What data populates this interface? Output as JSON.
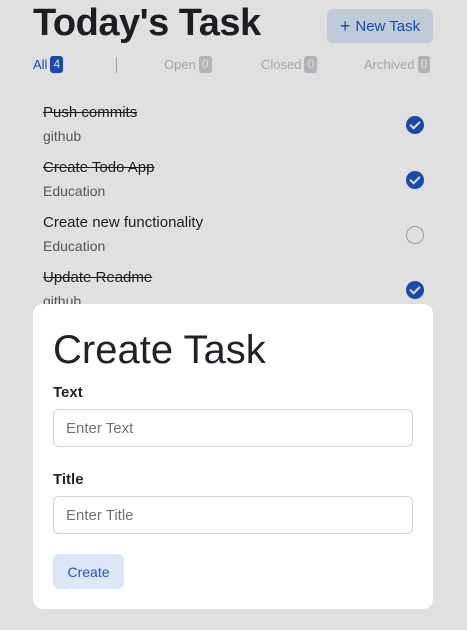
{
  "header": {
    "title": "Today's Task",
    "new_task_label": "New Task",
    "new_task_icon": "+"
  },
  "tabs": [
    {
      "label": "All",
      "count": "4",
      "active": true
    },
    {
      "label": "Open",
      "count": "0",
      "active": false
    },
    {
      "label": "Closed",
      "count": "0",
      "active": false
    },
    {
      "label": "Archived",
      "count": "0",
      "active": false
    }
  ],
  "tasks": [
    {
      "title": "Push commits",
      "subtitle": "github",
      "done": true
    },
    {
      "title": "Create Todo App",
      "subtitle": "Education",
      "done": true
    },
    {
      "title": "Create new functionality",
      "subtitle": "Education",
      "done": false
    },
    {
      "title": "Update Readme",
      "subtitle": "github",
      "done": true
    }
  ],
  "modal": {
    "title": "Create Task",
    "text_label": "Text",
    "text_placeholder": "Enter Text",
    "text_value": "",
    "title_label": "Title",
    "title_placeholder": "Enter Title",
    "title_value": "",
    "create_label": "Create"
  },
  "colors": {
    "accent": "#1a56c4",
    "button_bg": "#dbe7f7",
    "overlay": "rgba(0,0,0,0.12)"
  }
}
